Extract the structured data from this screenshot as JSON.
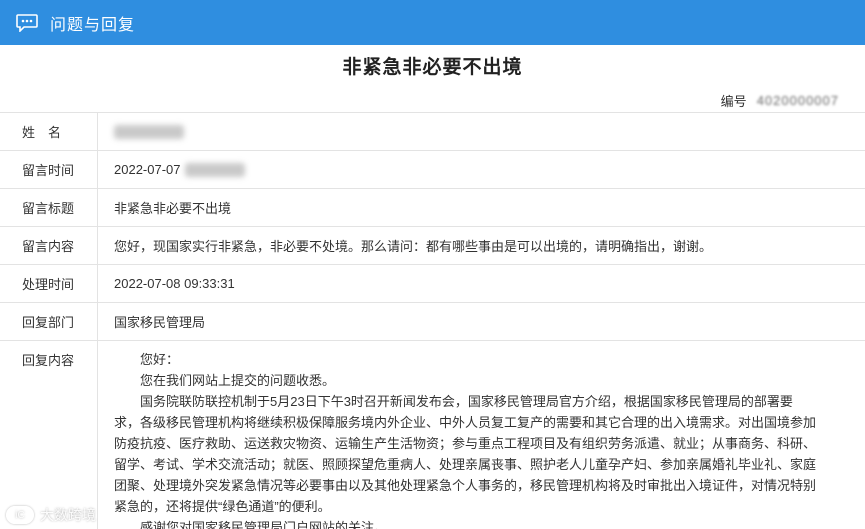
{
  "header": {
    "title": "问题与回复",
    "icon": "message-icon",
    "color": "#2f8ee0"
  },
  "page_title": "非紧急非必要不出境",
  "serial": {
    "label": "编号",
    "value": "4020000007"
  },
  "fields": {
    "name_label": "姓　名",
    "message_time_label": "留言时间",
    "message_time_value": "2022-07-07",
    "message_title_label": "留言标题",
    "message_title_value": "非紧急非必要不出境",
    "message_content_label": "留言内容",
    "message_content_value": "您好，现国家实行非紧急，非必要不处境。那么请问：都有哪些事由是可以出境的，请明确指出，谢谢。",
    "process_time_label": "处理时间",
    "process_time_value": "2022-07-08 09:33:31",
    "reply_dept_label": "回复部门",
    "reply_dept_value": "国家移民管理局",
    "reply_content_label": "回复内容"
  },
  "reply": {
    "greeting": "您好：",
    "line1": "您在我们网站上提交的问题收悉。",
    "line2": "国务院联防联控机制于5月23日下午3时召开新闻发布会，国家移民管理局官方介绍，根据国家移民管理局的部署要",
    "line3": "求，各级移民管理机构将继续积极保障服务境内外企业、中外人员复工复产的需要和其它合理的出入境需求。对出国境参加",
    "line4": "防疫抗疫、医疗救助、运送救灾物资、运输生产生活物资；参与重点工程项目及有组织劳务派遣、就业；从事商务、科研、",
    "line5": "留学、考试、学术交流活动；就医、照顾探望危重病人、处理亲属丧事、照护老人儿童孕产妇、参加亲属婚礼毕业礼、家庭",
    "line6": "团聚、处理境外突发紧急情况等必要事由以及其他处理紧急个人事务的，移民管理机构将及时审批出入境证件，对情况特别",
    "line7": "紧急的，还将提供“绿色通道”的便利。",
    "line8": "感谢您对国家移民管理局门户网站的关注。"
  },
  "watermark": {
    "badge": "iC",
    "text": "大数跨境"
  }
}
